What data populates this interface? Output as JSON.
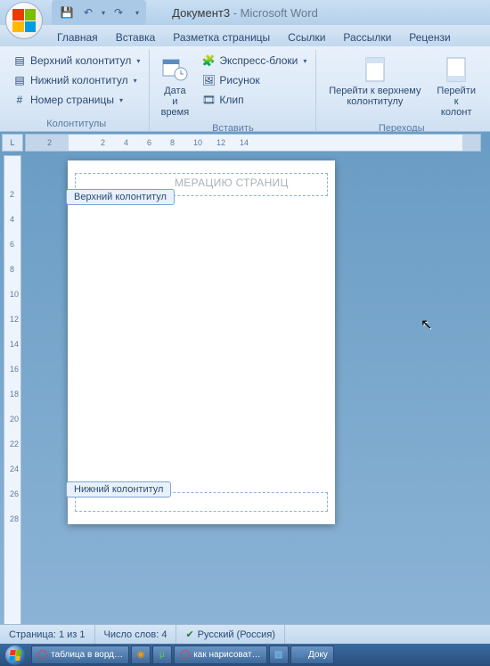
{
  "title": {
    "doc": "Документ3",
    "sep": " - ",
    "app": "Microsoft Word"
  },
  "qat": {
    "save": "💾",
    "undo": "↶",
    "redo": "↷"
  },
  "tabs": [
    "Главная",
    "Вставка",
    "Разметка страницы",
    "Ссылки",
    "Рассылки",
    "Рецензи"
  ],
  "ribbon": {
    "group1": {
      "label": "Колонтитулы",
      "header": "Верхний колонтитул",
      "footer": "Нижний колонтитул",
      "pagenum": "Номер страницы"
    },
    "group2": {
      "label": "Вставить",
      "datetime": "Дата и время",
      "quickparts": "Экспресс-блоки",
      "picture": "Рисунок",
      "clip": "Клип"
    },
    "group3": {
      "label": "Переходы",
      "gotoheader": "Перейти к верхнему колонтитулу",
      "gotofooter_l1": "Перейти к",
      "gotofooter_l2": "колонт"
    }
  },
  "hruler": {
    "left_margin": "2",
    "ticks": [
      "2",
      "4",
      "6",
      "8",
      "10",
      "12",
      "14"
    ]
  },
  "vruler": {
    "ticks": [
      "2",
      "4",
      "6",
      "8",
      "10",
      "12",
      "14",
      "16",
      "18",
      "20",
      "22",
      "24",
      "26",
      "28"
    ]
  },
  "page": {
    "header_tab": "Верхний колонтитул",
    "footer_tab": "Нижний колонтитул",
    "header_text": "МЕРАЦИЮ СТРАНИЦ"
  },
  "status": {
    "page": "Страница: 1 из 1",
    "words": "Число слов: 4",
    "lang": "Русский (Россия)"
  },
  "taskbar": {
    "items": [
      "таблица в ворд…",
      "",
      "",
      "как нарисоват…",
      "",
      "Доку"
    ]
  }
}
